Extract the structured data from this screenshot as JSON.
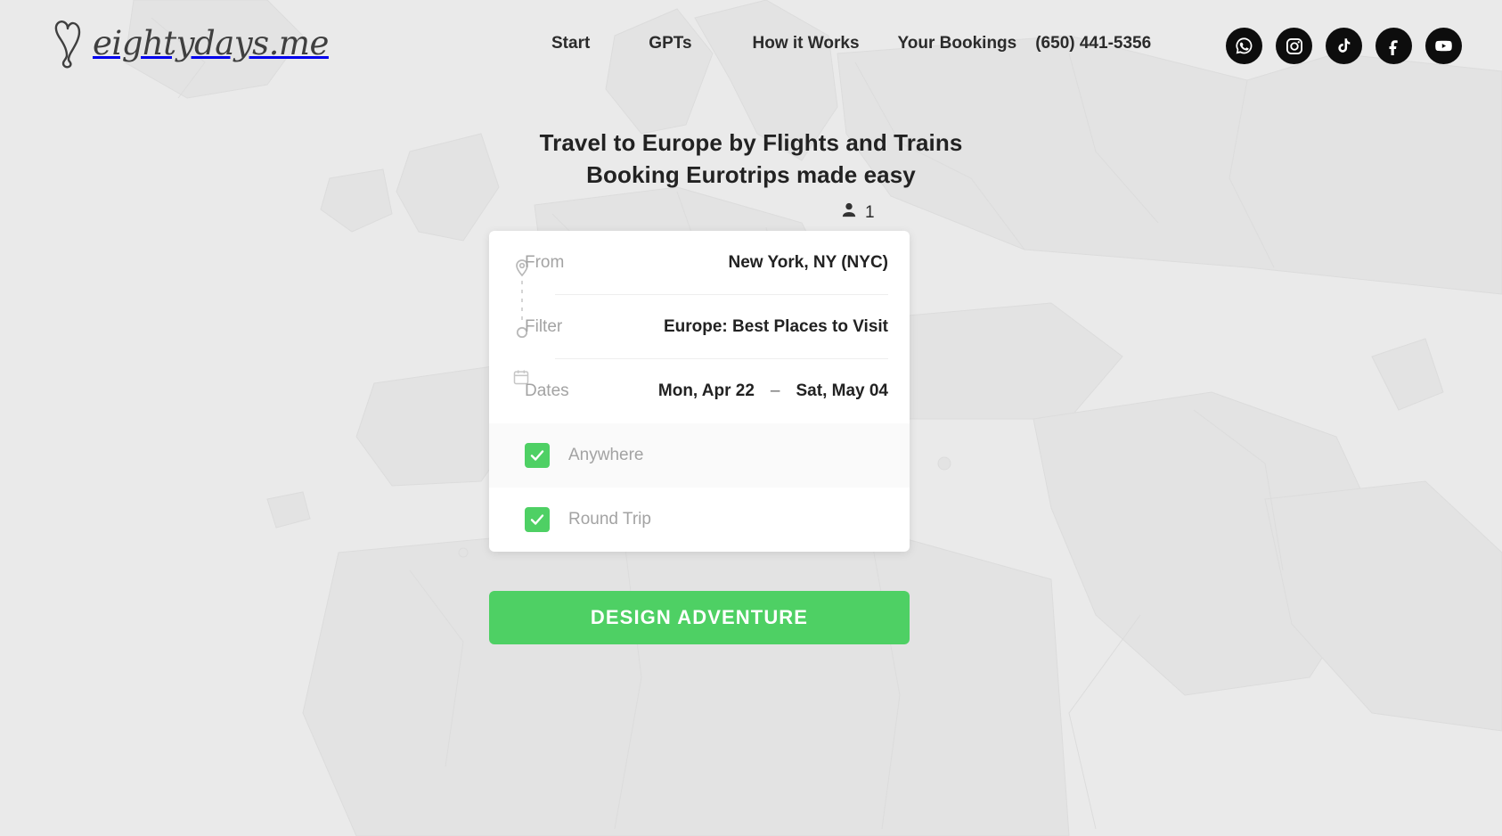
{
  "brand": {
    "name": "eightydays.me",
    "logo_icon": "balloon-pin-icon"
  },
  "header": {
    "nav": [
      {
        "label": "Start",
        "name": "nav-start"
      },
      {
        "label": "GPTs",
        "name": "nav-gpts"
      },
      {
        "label": "How it Works",
        "name": "nav-how-it-works"
      },
      {
        "label": "Your Bookings",
        "name": "nav-your-bookings"
      }
    ],
    "phone": "(650) 441-5356",
    "socials": [
      {
        "name": "whatsapp-icon",
        "label": "WhatsApp"
      },
      {
        "name": "instagram-icon",
        "label": "Instagram"
      },
      {
        "name": "tiktok-icon",
        "label": "TikTok"
      },
      {
        "name": "facebook-icon",
        "label": "Facebook"
      },
      {
        "name": "youtube-icon",
        "label": "YouTube"
      }
    ]
  },
  "hero": {
    "headline_line1": "Travel to Europe by Flights and Trains",
    "headline_line2": "Booking Eurotrips made easy"
  },
  "search": {
    "passengers": {
      "icon": "person-icon",
      "count": "1"
    },
    "from": {
      "label": "From",
      "value": "New York, NY (NYC)",
      "icon": "origin-pin-icon"
    },
    "filter": {
      "label": "Filter",
      "value": "Europe: Best Places to Visit",
      "icon": "destination-circle-icon"
    },
    "dates": {
      "label": "Dates",
      "start": "Mon, Apr 22",
      "separator": "–",
      "end": "Sat, May 04",
      "icon": "calendar-icon"
    },
    "options": [
      {
        "label": "Anywhere",
        "checked": true,
        "name": "checkbox-anywhere"
      },
      {
        "label": "Round Trip",
        "checked": true,
        "name": "checkbox-round-trip"
      }
    ],
    "submit_label": "DESIGN ADVENTURE"
  },
  "colors": {
    "accent_green": "#4ed064",
    "page_bg": "#eaeaea",
    "card_bg": "#ffffff",
    "text_dark": "#222222",
    "text_muted": "#a3a3a3",
    "social_bg": "#0d0d0d"
  }
}
